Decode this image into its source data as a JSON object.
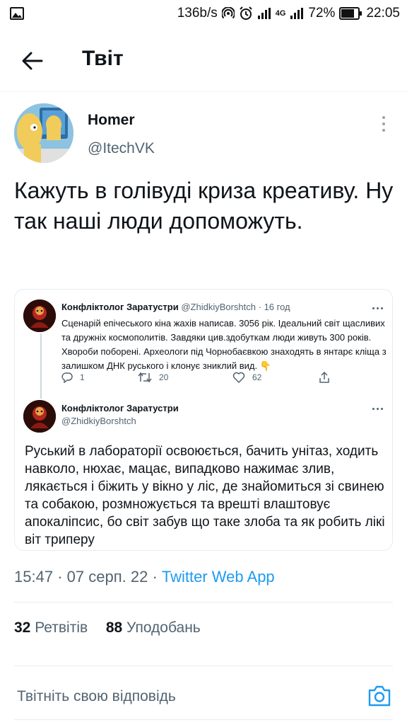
{
  "status_bar": {
    "speed": "136b/s",
    "network": "4G",
    "battery": "72%",
    "time": "22:05"
  },
  "header": {
    "title": "Твіт"
  },
  "tweet": {
    "author_name": "Homer",
    "author_handle": "@ItechVK",
    "text": "Кажуть в голівуді криза креативу. Ну так наші люди допоможуть.",
    "time": "15:47",
    "date": "07 серп. 22",
    "source": "Twitter Web App",
    "separator": "·",
    "retweets_count": "32",
    "retweets_label": "Ретвітів",
    "likes_count": "88",
    "likes_label": "Уподобань"
  },
  "quoted": {
    "first": {
      "name": "Конфліктолог Заратустри",
      "handle": "@ZhidkiyBorshtch",
      "age": "· 16 год",
      "text": "Сценарій епічеського кіна жахів написав. 3056 рік. Ідеальний світ щасливих та дружніх космополитів. Завдяки цив.здобуткам люди живуть 300 років. Хвороби поборені. Археологи під Чорнобаєвкою знаходять в янтарє кліща з залишком ДНК руського і клонує зниклий вид. 👇",
      "replies": "1",
      "retweets": "20",
      "likes": "62"
    },
    "second": {
      "name": "Конфліктолог Заратустри",
      "handle": "@ZhidkiyBorshtch",
      "text": "Руський в лабораторії освоюється, бачить унітаз, ходить навколо, нюхає, мацає, випадково нажимає злив, лякається і біжить у вікно у ліс, де знайомиться зі свинею та собакою, розмножується та врешті влаштовує апокаліпсис, бо світ забув що таке злоба та як робить лікі віт триперу"
    }
  },
  "reply": {
    "placeholder": "Твітніть свою відповідь"
  },
  "colors": {
    "accent": "#1d9bf0",
    "text": "#0f1419",
    "secondary": "#536471",
    "border": "#e6ecf0"
  },
  "icons": {
    "back": "arrow-left-icon",
    "more": "more-vertical-icon",
    "camera": "camera-icon",
    "reply": "reply-icon",
    "retweet": "retweet-icon",
    "like": "heart-icon",
    "share": "share-icon"
  }
}
